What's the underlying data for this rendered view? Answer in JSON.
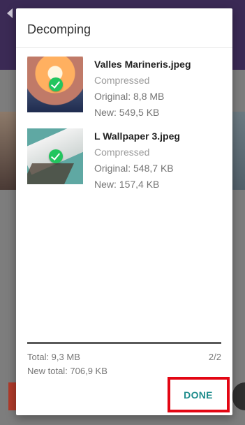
{
  "dialog": {
    "title": "Decomping"
  },
  "files": [
    {
      "name": "Valles Marineris.jpeg",
      "status": "Compressed",
      "original": "Original: 8,8 MB",
      "new": "New: 549,5 KB"
    },
    {
      "name": "L Wallpaper 3.jpeg",
      "status": "Compressed",
      "original": "Original: 548,7 KB",
      "new": "New: 157,4 KB"
    }
  ],
  "summary": {
    "total": "Total: 9,3 MB",
    "new_total": "New total: 706,9 KB",
    "count": "2/2",
    "progress": 1.0
  },
  "actions": {
    "done_label": "DONE"
  },
  "colors": {
    "accent": "#1e8c8c",
    "success": "#22c55e",
    "highlight": "#e30613",
    "toolbar": "#3b2a55"
  }
}
